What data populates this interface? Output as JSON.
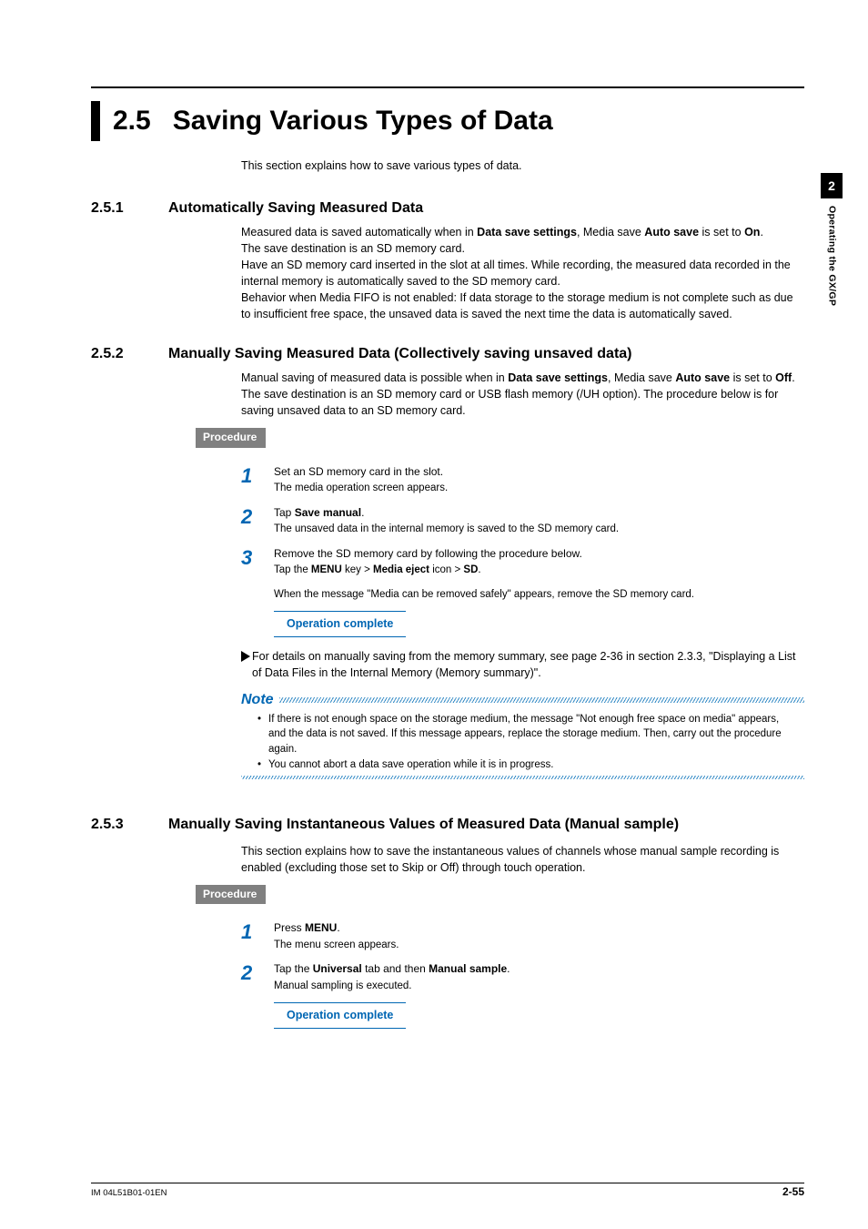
{
  "sideTab": {
    "number": "2",
    "label": "Operating the GX/GP"
  },
  "title": {
    "number": "2.5",
    "text": "Saving Various Types of Data"
  },
  "intro": "This section explains how to save various types of data.",
  "sec251": {
    "num": "2.5.1",
    "title": "Automatically Saving Measured Data",
    "p1a": "Measured data is saved automatically when in ",
    "p1b": "Data save settings",
    "p1c": ", Media save ",
    "p1d": "Auto save",
    "p1e": " is set to ",
    "p1f": "On",
    "p1g": ".",
    "p2": "The save destination is an SD memory card.",
    "p3": "Have an SD memory card inserted in the slot at all times. While recording, the measured data recorded in the internal memory is automatically saved to the SD memory card.",
    "p4": "Behavior when Media FIFO is not enabled: If data storage to the storage medium is not complete such as due to insufficient free space, the unsaved data is saved the next time the data is automatically saved."
  },
  "sec252": {
    "num": "2.5.2",
    "title": "Manually Saving Measured Data (Collectively saving unsaved data)",
    "p1a": "Manual saving of measured data is possible when in ",
    "p1b": "Data save settings",
    "p1c": ", Media save ",
    "p1d": "Auto save",
    "p1e": " is set to ",
    "p1f": "Off",
    "p1g": ".",
    "p2": "The save destination is an SD memory card or USB flash memory (/UH option). The procedure below is for saving unsaved data to an SD memory card.",
    "procedureLabel": "Procedure",
    "steps": {
      "s1a": "Set an SD memory card in the slot.",
      "s1b": "The media operation screen appears.",
      "s2a_pre": "Tap ",
      "s2a_b": "Save manual",
      "s2a_post": ".",
      "s2b": "The unsaved data in the internal memory is saved to the SD memory card.",
      "s3a": "Remove the SD memory card by following the procedure below.",
      "s3b_pre": " Tap the ",
      "s3b_b1": "MENU",
      "s3b_mid1": " key > ",
      "s3b_b2": "Media eject",
      "s3b_mid2": " icon > ",
      "s3b_b3": "SD",
      "s3b_post": ".",
      "s3c": "When the message \"Media can be removed safely\" appears, remove the SD memory card."
    },
    "opComplete": "Operation complete",
    "ref": "For details on manually saving from the memory summary, see page 2-36 in section 2.3.3, \"Displaying a List of Data Files in the Internal Memory (Memory summary)\".",
    "noteWord": "Note",
    "noteItems": [
      "If there is not enough space on the storage medium, the message \"Not enough free space on media\" appears, and the data is not saved. If this message appears, replace the storage medium. Then, carry out the procedure again.",
      "You cannot abort a data save operation while it is in progress."
    ]
  },
  "sec253": {
    "num": "2.5.3",
    "title": "Manually Saving Instantaneous Values of Measured Data (Manual sample)",
    "p1": "This section explains how to save the instantaneous values of channels whose manual sample recording is enabled (excluding those set to Skip or Off) through touch operation.",
    "procedureLabel": "Procedure",
    "steps": {
      "s1a_pre": "Press ",
      "s1a_b": "MENU",
      "s1a_post": ".",
      "s1b": "The menu screen appears.",
      "s2a_pre": "Tap the ",
      "s2a_b1": "Universal",
      "s2a_mid": " tab and then ",
      "s2a_b2": "Manual sample",
      "s2a_post": ".",
      "s2b": "Manual sampling is executed."
    },
    "opComplete": "Operation complete"
  },
  "footer": {
    "left": "IM 04L51B01-01EN",
    "right": "2-55"
  },
  "stepNums": {
    "one": "1",
    "two": "2",
    "three": "3"
  }
}
